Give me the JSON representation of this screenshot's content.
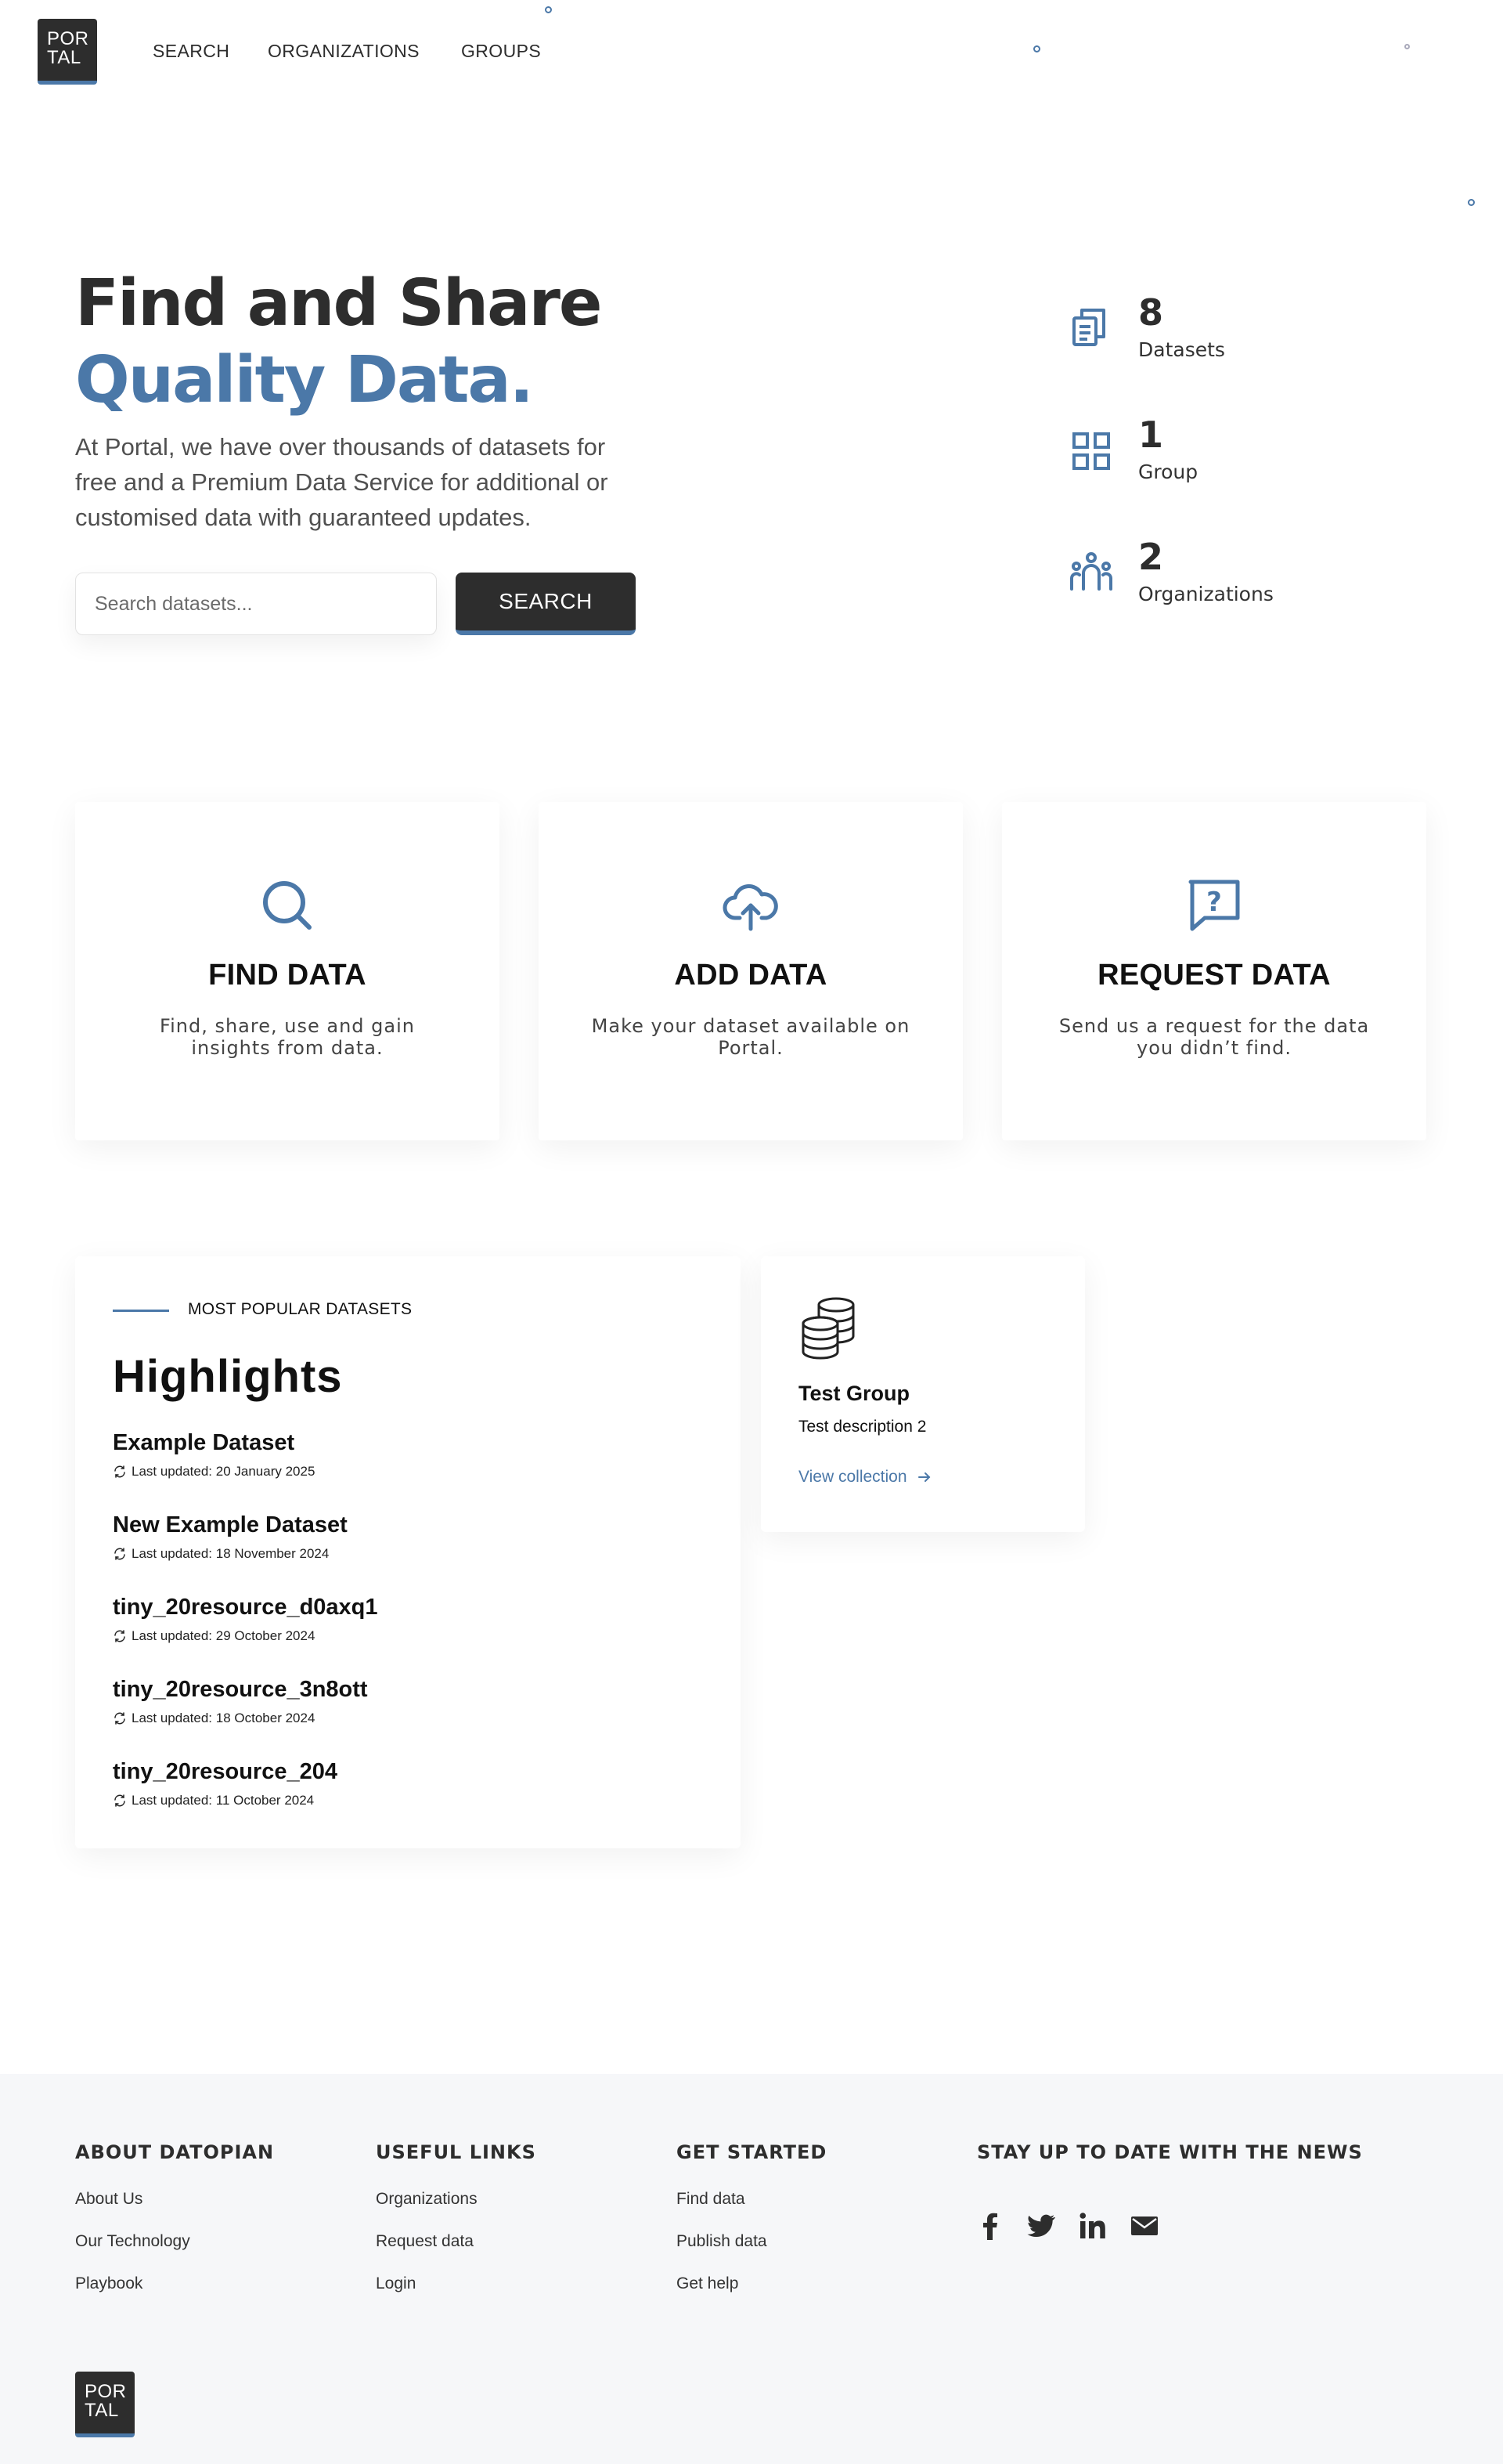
{
  "header": {
    "logo": [
      "POR",
      "TAL"
    ],
    "nav": [
      "SEARCH",
      "ORGANIZATIONS",
      "GROUPS"
    ]
  },
  "hero": {
    "title_line1": "Find and Share",
    "title_line2": "Quality Data.",
    "subtitle": "At Portal, we have over thousands of datasets for free and a Premium Data Service for additional or customised data with guaranteed updates.",
    "search_placeholder": "Search datasets...",
    "search_button": "SEARCH"
  },
  "stats": [
    {
      "value": "8",
      "label": "Datasets",
      "icon": "documents-icon"
    },
    {
      "value": "1",
      "label": "Group",
      "icon": "grid-icon"
    },
    {
      "value": "2",
      "label": "Organizations",
      "icon": "people-icon"
    }
  ],
  "features": [
    {
      "title": "FIND DATA",
      "desc": "Find, share, use and gain insights from data.",
      "icon": "search-icon"
    },
    {
      "title": "ADD DATA",
      "desc": "Make your dataset available on Portal.",
      "icon": "cloud-upload-icon"
    },
    {
      "title": "REQUEST DATA",
      "desc": "Send us a request for the data you didn’t find.",
      "icon": "question-message-icon"
    }
  ],
  "highlights": {
    "kicker": "MOST POPULAR DATASETS",
    "title": "Highlights",
    "datasets": [
      {
        "name": "Example Dataset",
        "updated": "Last updated: 20 January 2025"
      },
      {
        "name": "New Example Dataset",
        "updated": "Last updated: 18 November 2024"
      },
      {
        "name": "tiny_20resource_d0axq1",
        "updated": "Last updated: 29 October 2024"
      },
      {
        "name": "tiny_20resource_3n8ott",
        "updated": "Last updated: 18 October 2024"
      },
      {
        "name": "tiny_20resource_204",
        "updated": "Last updated: 11 October 2024"
      }
    ]
  },
  "group_card": {
    "title": "Test Group",
    "description": "Test description 2",
    "link": "View collection",
    "icon": "database-icon"
  },
  "footer": {
    "columns": [
      {
        "heading": "ABOUT DATOPIAN",
        "links": [
          "About Us",
          "Our Technology",
          "Playbook"
        ]
      },
      {
        "heading": "USEFUL LINKS",
        "links": [
          "Organizations",
          "Request data",
          "Login"
        ]
      },
      {
        "heading": "GET STARTED",
        "links": [
          "Find data",
          "Publish data",
          "Get help"
        ]
      }
    ],
    "news_heading": "STAY UP TO DATE WITH THE NEWS",
    "social": [
      "facebook-icon",
      "twitter-icon",
      "linkedin-icon",
      "email-icon"
    ],
    "logo": [
      "POR",
      "TAL"
    ]
  },
  "colors": {
    "accent": "#4b78a8",
    "dark": "#2d2d2d",
    "footer_bg": "#f6f7f9"
  }
}
